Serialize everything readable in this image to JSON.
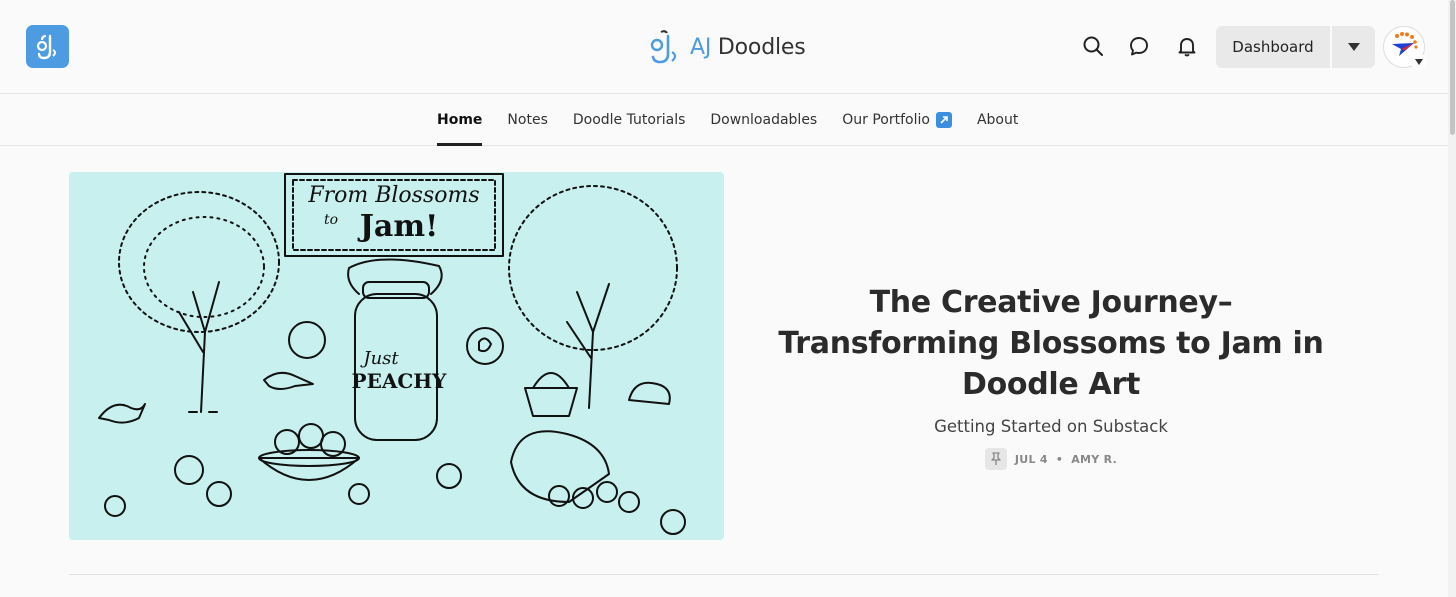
{
  "header": {
    "brand_prefix": "AJ",
    "brand_name": " Doodles",
    "dashboard_label": "Dashboard"
  },
  "icons": {
    "app": "jar-logo-icon",
    "search": "search-icon",
    "chat": "chat-bubble-icon",
    "notifications": "bell-icon",
    "caret": "caret-down-icon",
    "avatar": "paper-plane-avatar-icon",
    "external": "external-link-icon",
    "meta": "pin-icon"
  },
  "nav": {
    "items": [
      {
        "label": "Home",
        "active": true
      },
      {
        "label": "Notes"
      },
      {
        "label": "Doodle Tutorials"
      },
      {
        "label": "Downloadables"
      },
      {
        "label": "Our Portfolio"
      },
      {
        "label": "About"
      }
    ]
  },
  "post": {
    "title": "The Creative Journey–Transforming Blossoms to Jam in Doodle Art",
    "subtitle": "Getting Started on Substack",
    "date": "JUL 4",
    "separator": "•",
    "author": "AMY R.",
    "image_text": {
      "banner_line1": "From Blossoms",
      "banner_line2": "to",
      "banner_line3": "Jam!",
      "jar_line1": "Just",
      "jar_line2": "PEACHY"
    }
  },
  "colors": {
    "accent": "#4d9be0",
    "hero_bg": "#c8f0ef",
    "external_badge": "#3b8ee0",
    "avatar_orange": "#f07b1e",
    "avatar_blue": "#1f3fd6",
    "avatar_red": "#e0282e"
  }
}
